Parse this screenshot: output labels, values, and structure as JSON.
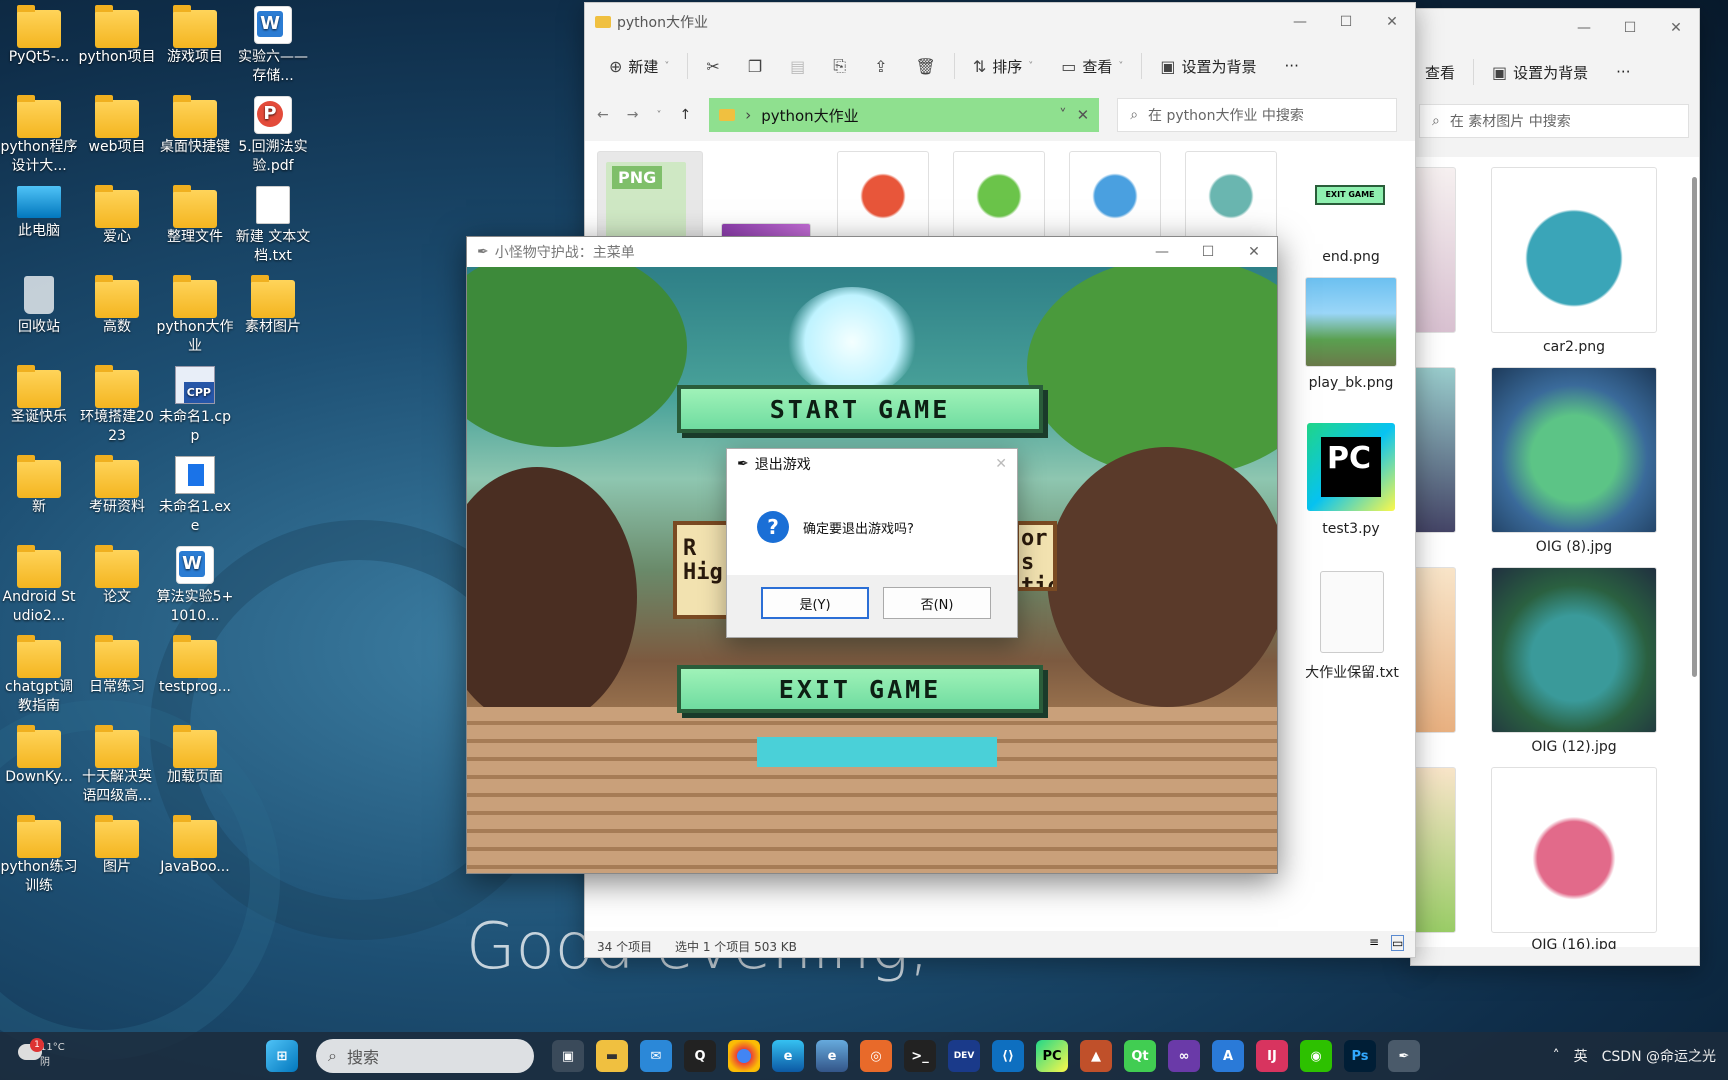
{
  "desktop": {
    "icons": [
      {
        "label": "PyQt5-...",
        "type": "folder"
      },
      {
        "label": "python项目",
        "type": "folder"
      },
      {
        "label": "游戏项目",
        "type": "folder"
      },
      {
        "label": "实验六——存储...",
        "type": "word"
      },
      {
        "label": "python程序设计大...",
        "type": "folder"
      },
      {
        "label": "web项目",
        "type": "folder"
      },
      {
        "label": "桌面快捷键",
        "type": "folder"
      },
      {
        "label": "5.回溯法实验.pdf",
        "type": "pdf"
      },
      {
        "label": "此电脑",
        "type": "pc"
      },
      {
        "label": "爱心",
        "type": "folder"
      },
      {
        "label": "整理文件",
        "type": "folder"
      },
      {
        "label": "新建 文本文档.txt",
        "type": "doc"
      },
      {
        "label": "回收站",
        "type": "bin"
      },
      {
        "label": "高数",
        "type": "folder"
      },
      {
        "label": "python大作业",
        "type": "folder"
      },
      {
        "label": "素材图片",
        "type": "folder"
      },
      {
        "label": "圣诞快乐",
        "type": "folder"
      },
      {
        "label": "环境搭建2023",
        "type": "folder"
      },
      {
        "label": "未命名1.cpp",
        "type": "cpp"
      },
      {
        "label": "",
        "type": "none"
      },
      {
        "label": "新",
        "type": "folder"
      },
      {
        "label": "考研资料",
        "type": "folder"
      },
      {
        "label": "未命名1.exe",
        "type": "exe"
      },
      {
        "label": "",
        "type": "none"
      },
      {
        "label": "Android Studio2...",
        "type": "folder"
      },
      {
        "label": "论文",
        "type": "folder"
      },
      {
        "label": "算法实验5+1010...",
        "type": "word"
      },
      {
        "label": "",
        "type": "none"
      },
      {
        "label": "chatgpt调教指南",
        "type": "folder"
      },
      {
        "label": "日常练习",
        "type": "folder"
      },
      {
        "label": "testprog...",
        "type": "folder"
      },
      {
        "label": "",
        "type": "none"
      },
      {
        "label": "DownKy...",
        "type": "folder"
      },
      {
        "label": "十天解决英语四级高...",
        "type": "folder"
      },
      {
        "label": "加载页面",
        "type": "folder"
      },
      {
        "label": "",
        "type": "none"
      },
      {
        "label": "python练习训练",
        "type": "folder"
      },
      {
        "label": "图片",
        "type": "folder"
      },
      {
        "label": "JavaBoo...",
        "type": "folder"
      }
    ],
    "greeting": "Good evening,"
  },
  "explorer_back": {
    "toolbar": {
      "view": "查看",
      "set_bg": "设置为背景",
      "more": "···"
    },
    "search_placeholder": "在 素材图片 中搜索",
    "files": [
      "car2.png",
      "OIG (8).jpg",
      "OIG (12).jpg",
      "OIG (16).jpg"
    ]
  },
  "explorer_front": {
    "title": "python大作业",
    "toolbar": {
      "new": "新建",
      "sort": "排序",
      "view": "查看",
      "set_bg": "设置为背景",
      "more": "···"
    },
    "path": "python大作业",
    "search_placeholder": "在 python大作业 中搜索",
    "files_right": [
      "end.png",
      "play_bk.png",
      "test3.py",
      "大作业保留.txt"
    ],
    "png_label": "PNG",
    "end_thumb_text": "EXIT GAME",
    "status_count": "34 个项目",
    "status_selected": "选中 1 个项目  503 KB"
  },
  "game": {
    "title": "小怪物守护战：主菜单",
    "start": "START GAME",
    "exit": "EXIT GAME",
    "left_side": "R\nHig",
    "right_side": "or\ns\ntion"
  },
  "dialog": {
    "title": "退出游戏",
    "message": "确定要退出游戏吗?",
    "yes": "是(Y)",
    "no": "否(N)"
  },
  "taskbar": {
    "weather": "11°C\n阴",
    "search": "搜索",
    "ime": "英",
    "watermark": "CSDN @命运之光"
  },
  "colors": {
    "path_highlight": "#8fe08f",
    "accent": "#1a6fd6",
    "pix_button": "#8ff0b0"
  }
}
